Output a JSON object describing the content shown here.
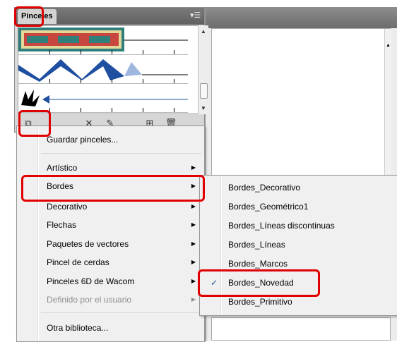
{
  "panel": {
    "tab_label": "Pinceles",
    "menu_icon": "▾☰"
  },
  "toolbar": [
    {
      "name": "brush-libraries-menu-icon",
      "glyph": "⧉"
    },
    {
      "name": "remove-stroke-icon",
      "glyph": "✕"
    },
    {
      "name": "options-icon",
      "glyph": "✎"
    },
    {
      "name": "new-brush-icon",
      "glyph": "⊞"
    },
    {
      "name": "delete-brush-icon",
      "glyph": "🗑"
    }
  ],
  "menu": {
    "save": "Guardar pinceles...",
    "items": [
      {
        "label": "Artístico",
        "submenu": true
      },
      {
        "label": "Bordes",
        "submenu": true
      },
      {
        "label": "Decorativo",
        "submenu": true
      },
      {
        "label": "Flechas",
        "submenu": true
      },
      {
        "label": "Paquetes de vectores",
        "submenu": true
      },
      {
        "label": "Pincel de cerdas",
        "submenu": true
      },
      {
        "label": "Pinceles 6D de Wacom",
        "submenu": true
      },
      {
        "label": "Definido por el usuario",
        "submenu": true,
        "disabled": true
      }
    ],
    "other": "Otra biblioteca..."
  },
  "submenu": {
    "items": [
      {
        "label": "Bordes_Decorativo",
        "checked": false
      },
      {
        "label": "Bordes_Geométrico1",
        "checked": false
      },
      {
        "label": "Bordes_Líneas discontinuas",
        "checked": false
      },
      {
        "label": "Bordes_Líneas",
        "checked": false
      },
      {
        "label": "Bordes_Marcos",
        "checked": false
      },
      {
        "label": "Bordes_Novedad",
        "checked": true
      },
      {
        "label": "Bordes_Primitivo",
        "checked": false
      }
    ]
  },
  "colors": {
    "highlight": "#e10000",
    "check": "#1d4f9c"
  }
}
